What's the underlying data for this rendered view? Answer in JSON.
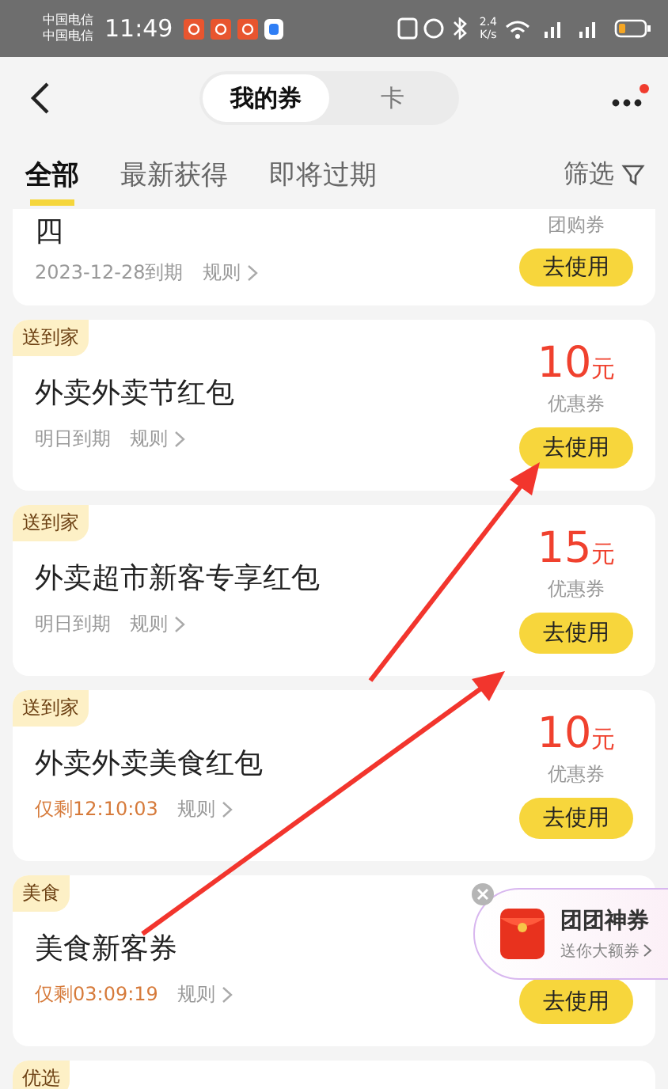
{
  "status_bar": {
    "carriers": [
      "中国电信",
      "中国电信"
    ],
    "time": "11:49",
    "speed": [
      "2.4",
      "K/s"
    ]
  },
  "header": {
    "tabs": [
      {
        "label": "我的券",
        "selected": true
      },
      {
        "label": "卡",
        "selected": false
      }
    ],
    "more_notification": true
  },
  "filters": [
    {
      "label": "全部",
      "selected": true
    },
    {
      "label": "最新获得",
      "selected": false
    },
    {
      "label": "即将过期",
      "selected": false
    }
  ],
  "filter_button": "筛选",
  "coupons": [
    {
      "kind": "partial",
      "title": "四",
      "type_label": "团购券",
      "expiry": "2023-12-28到期",
      "urgent": false,
      "rules": "规则",
      "button": "去使用"
    },
    {
      "kind": "full",
      "tag": "送到家",
      "title": "外卖外卖节红包",
      "amount": "10",
      "unit": "元",
      "type_label": "优惠券",
      "expiry": "明日到期",
      "urgent": false,
      "rules": "规则",
      "button": "去使用"
    },
    {
      "kind": "full",
      "tag": "送到家",
      "title": "外卖超市新客专享红包",
      "amount": "15",
      "unit": "元",
      "type_label": "优惠券",
      "expiry": "明日到期",
      "urgent": false,
      "rules": "规则",
      "button": "去使用"
    },
    {
      "kind": "full",
      "tag": "送到家",
      "title": "外卖外卖美食红包",
      "amount": "10",
      "unit": "元",
      "type_label": "优惠券",
      "expiry": "仅剩12:10:03",
      "urgent": true,
      "rules": "规则",
      "button": "去使用"
    },
    {
      "kind": "full",
      "tag": "美食",
      "title": "美食新客券",
      "expiry": "仅剩03:09:19",
      "urgent": true,
      "rules": "规则",
      "button": "去使用"
    },
    {
      "kind": "stub",
      "tag": "优选"
    }
  ],
  "promo": {
    "title": "团团神券",
    "subtitle": "送你大额券"
  }
}
